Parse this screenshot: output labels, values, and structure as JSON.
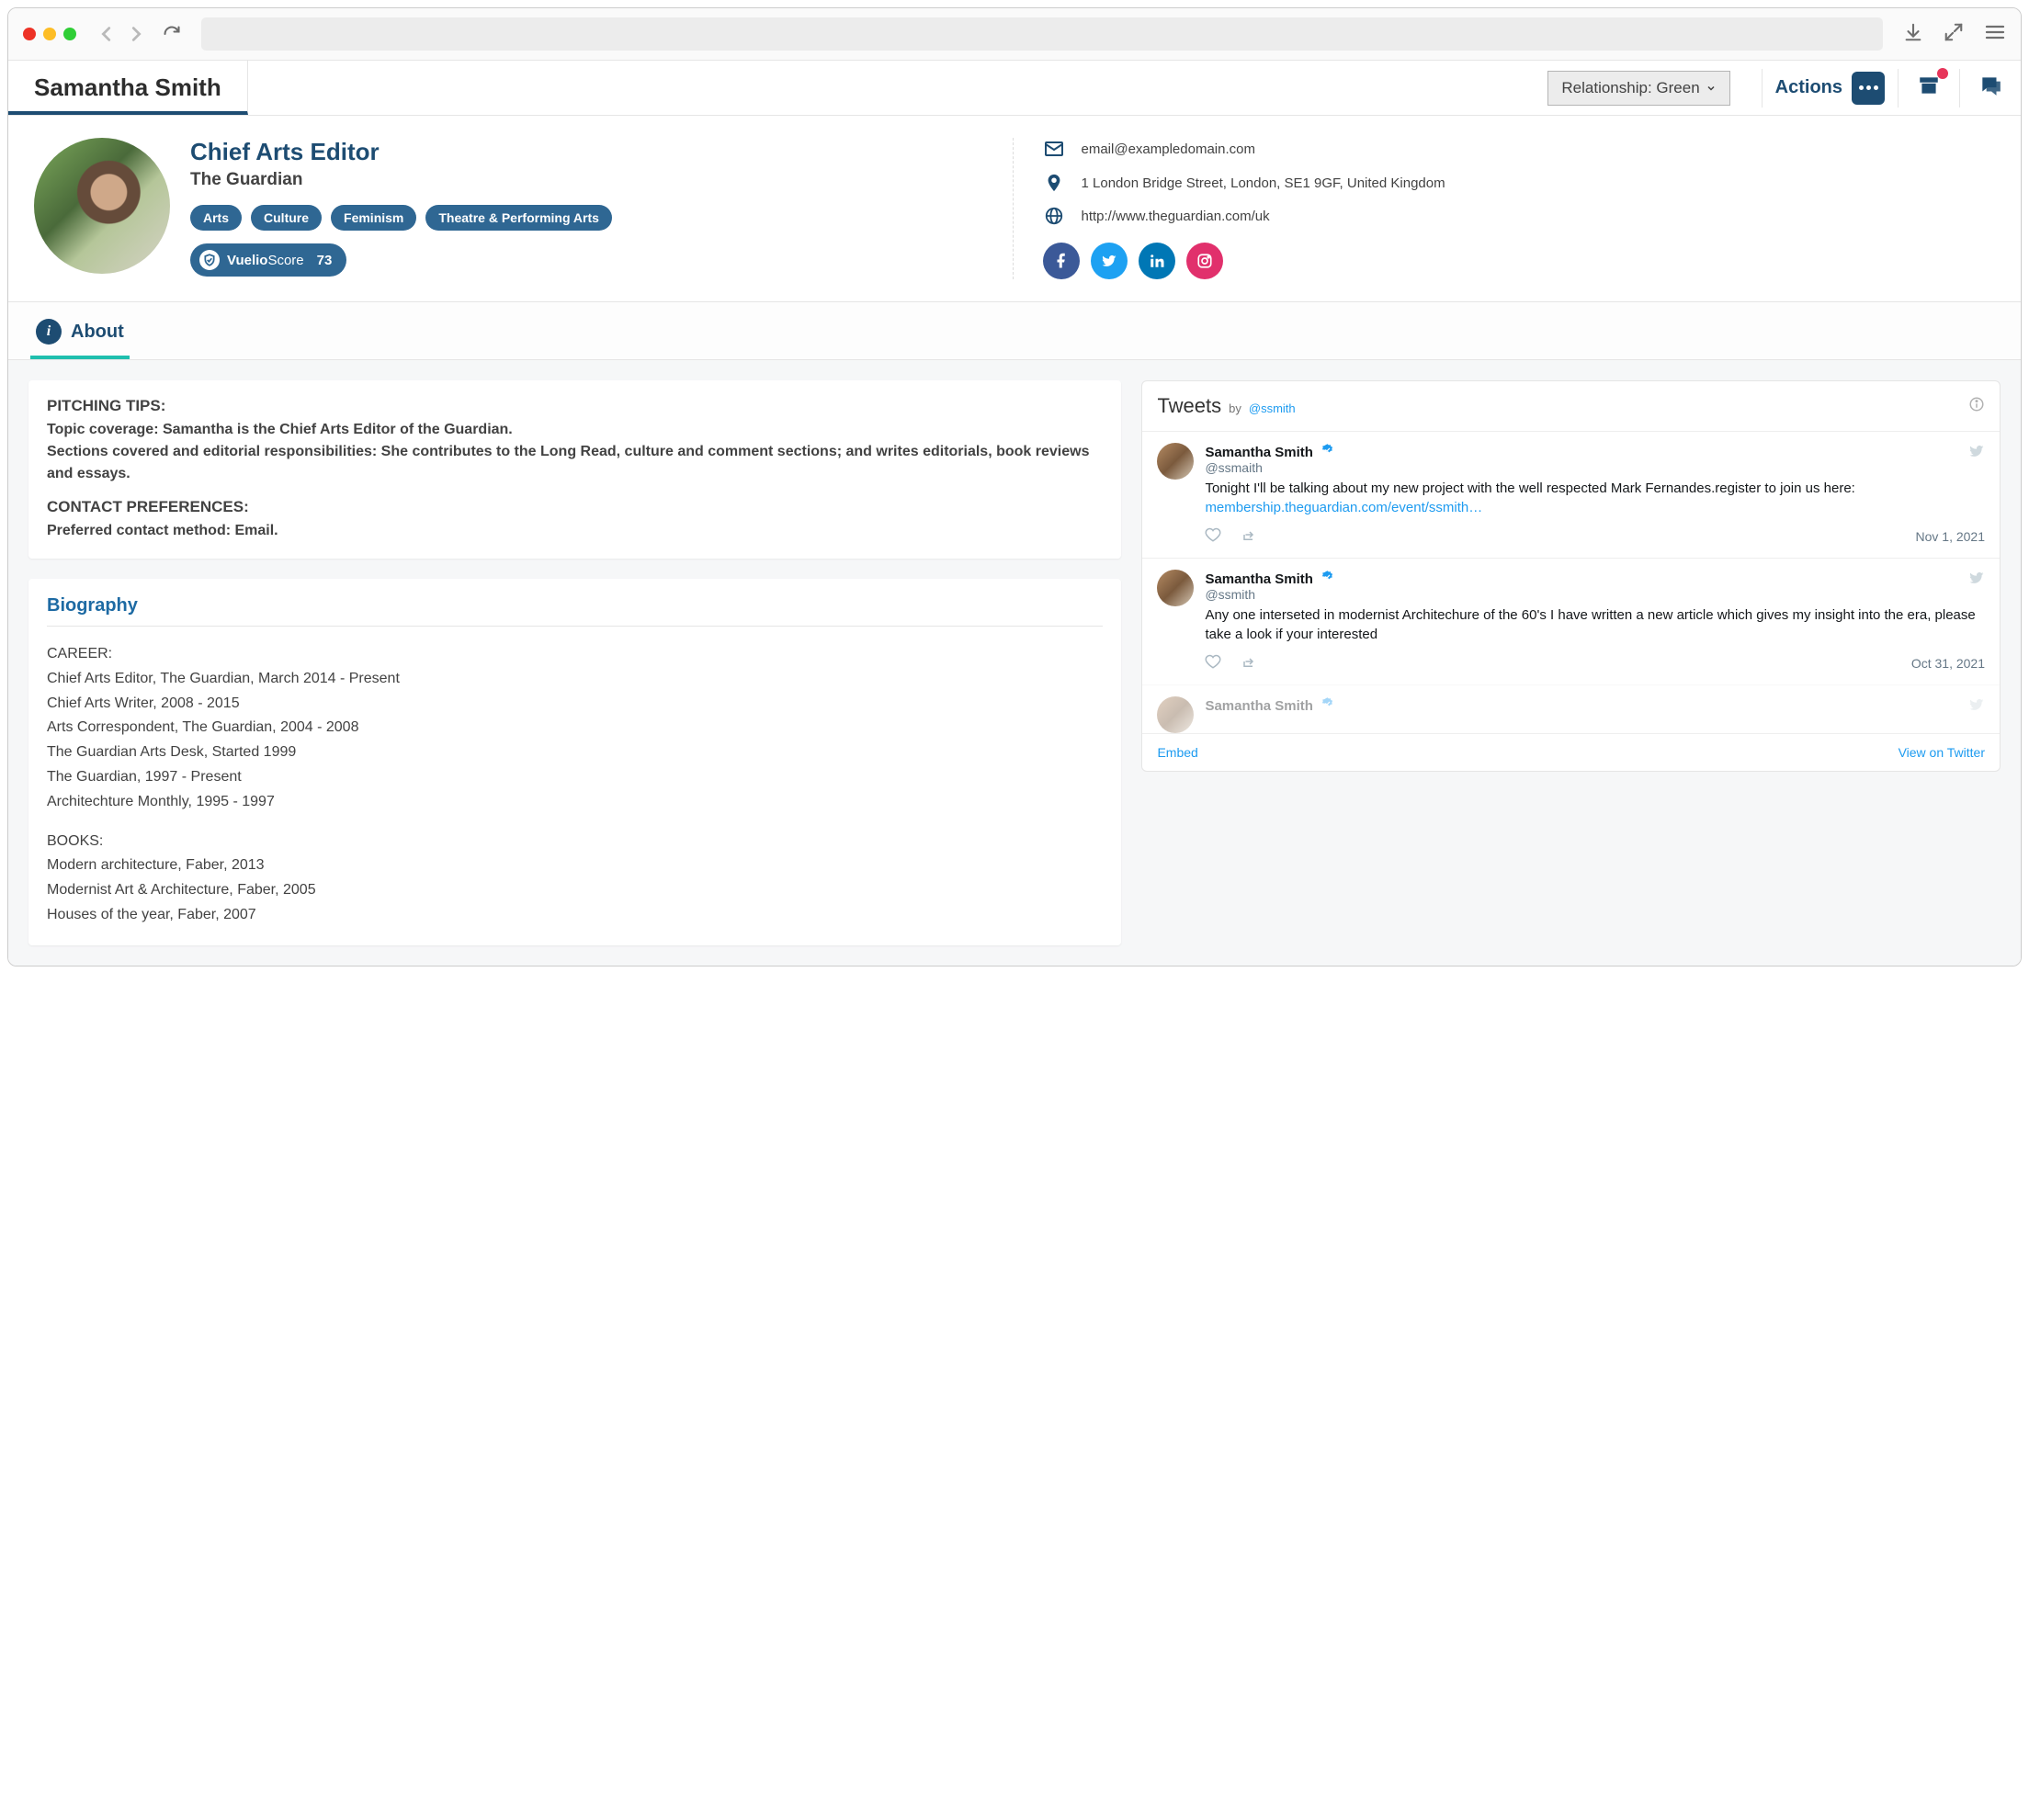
{
  "person": {
    "name": "Samantha Smith",
    "jobTitle": "Chief Arts Editor",
    "outlet": "The Guardian",
    "tags": [
      "Arts",
      "Culture",
      "Feminism",
      "Theatre & Performing Arts"
    ],
    "vuelioLabelBold": "Vuelio",
    "vuelioLabelThin": "Score",
    "vuelioScore": "73"
  },
  "header": {
    "relationshipLabel": "Relationship: Green",
    "actionsLabel": "Actions"
  },
  "contact": {
    "email": "email@exampledomain.com",
    "address": "1 London Bridge Street, London, SE1 9GF, United Kingdom",
    "website": "http://www.theguardian.com/uk"
  },
  "about": {
    "tabLabel": "About",
    "pitchingTitle": "PITCHING TIPS:",
    "pitchingLine1": "Topic coverage: Samantha is the Chief Arts Editor of the Guardian.",
    "pitchingLine2": "Sections covered and editorial responsibilities: She contributes to the Long Read, culture and comment sections; and writes editorials, book reviews and essays.",
    "contactPrefTitle": "CONTACT PREFERENCES:",
    "contactPrefLine": "Preferred contact method: Email."
  },
  "biography": {
    "title": "Biography",
    "careerHead": "CAREER:",
    "career": [
      "Chief Arts Editor, The Guardian, March 2014 - Present",
      "Chief Arts Writer, 2008 - 2015",
      "Arts Correspondent, The Guardian, 2004 - 2008",
      "The Guardian Arts Desk, Started 1999",
      "The Guardian, 1997 - Present",
      "Architechture Monthly, 1995 - 1997"
    ],
    "booksHead": "BOOKS:",
    "books": [
      "Modern architecture, Faber, 2013",
      "Modernist Art & Architecture, Faber, 2005",
      "Houses of the year, Faber, 2007"
    ]
  },
  "tweets": {
    "title": "Tweets",
    "by": "by",
    "handle": "@ssmith",
    "embed": "Embed",
    "viewOn": "View on Twitter",
    "items": [
      {
        "name": "Samantha Smith",
        "handle": "@ssmaith",
        "text": "Tonight I'll be talking about my new project with the well respected Mark Fernandes.register to join us here:",
        "link": "membership.theguardian.com/event/ssmith…",
        "date": "Nov 1, 2021"
      },
      {
        "name": "Samantha Smith",
        "handle": "@ssmith",
        "text": "Any one interseted in modernist Architechure of the 60's I have written a new article which gives my insight into the era, please take a look if your interested",
        "link": "",
        "date": "Oct 31, 2021"
      },
      {
        "name": "Samantha Smith",
        "handle": "",
        "text": "",
        "link": "",
        "date": ""
      }
    ]
  }
}
